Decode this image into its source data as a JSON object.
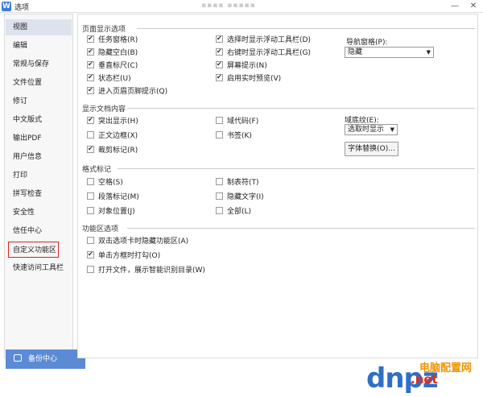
{
  "window": {
    "app_icon": "W",
    "title": "选项",
    "blurred_text": "▪▪▪▪ ▪▪▪▪▪"
  },
  "sidebar": {
    "items": [
      {
        "label": "视图"
      },
      {
        "label": "编辑"
      },
      {
        "label": "常规与保存"
      },
      {
        "label": "文件位置"
      },
      {
        "label": "修订"
      },
      {
        "label": "中文版式"
      },
      {
        "label": "输出PDF"
      },
      {
        "label": "用户信息"
      },
      {
        "label": "打印"
      },
      {
        "label": "拼写检查"
      },
      {
        "label": "安全性"
      },
      {
        "label": "信任中心"
      },
      {
        "label": "自定义功能区"
      },
      {
        "label": "快速访问工具栏"
      }
    ]
  },
  "backup": {
    "label": "备份中心"
  },
  "sections": {
    "page_display": {
      "title": "页面显示选项",
      "col1": [
        {
          "label": "任务窗格(R)",
          "checked": true
        },
        {
          "label": "隐藏空白(B)",
          "checked": true
        },
        {
          "label": "垂直标尺(C)",
          "checked": true
        },
        {
          "label": "状态栏(U)",
          "checked": true
        },
        {
          "label": "进入页眉页脚提示(Q)",
          "checked": true
        }
      ],
      "col2": [
        {
          "label": "选择时显示浮动工具栏(D)",
          "checked": true
        },
        {
          "label": "右键时显示浮动工具栏(G)",
          "checked": true
        },
        {
          "label": "屏幕提示(N)",
          "checked": true
        },
        {
          "label": "启用实时预览(V)",
          "checked": true
        }
      ],
      "nav_label": "导航窗格(P):",
      "nav_value": "隐藏"
    },
    "doc_content": {
      "title": "显示文档内容",
      "col1": [
        {
          "label": "突出显示(H)",
          "checked": true
        },
        {
          "label": "正文边框(X)",
          "checked": false
        },
        {
          "label": "裁剪标记(R)",
          "checked": true
        }
      ],
      "col2": [
        {
          "label": "域代码(F)",
          "checked": false
        },
        {
          "label": "书签(K)",
          "checked": false
        }
      ],
      "shading_label": "域底纹(E):",
      "shading_value": "选取时显示",
      "font_button": "字体替换(O)..."
    },
    "format_marks": {
      "title": "格式标记",
      "col1": [
        {
          "label": "空格(S)",
          "checked": false
        },
        {
          "label": "段落标记(M)",
          "checked": false
        },
        {
          "label": "对象位置(J)",
          "checked": false
        }
      ],
      "col2": [
        {
          "label": "制表符(T)",
          "checked": false
        },
        {
          "label": "隐藏文字(I)",
          "checked": false
        },
        {
          "label": "全部(L)",
          "checked": false
        }
      ]
    },
    "ribbon": {
      "title": "功能区选项",
      "items": [
        {
          "label": "双击选项卡时隐藏功能区(A)",
          "checked": false
        },
        {
          "label": "单击方框时打勾(O)",
          "checked": true
        },
        {
          "label": "打开文件，展示智能识别目录(W)",
          "checked": false
        }
      ]
    }
  },
  "watermark": {
    "main": "dnpz",
    "sub": "电脑配置网",
    "url": ".net"
  }
}
